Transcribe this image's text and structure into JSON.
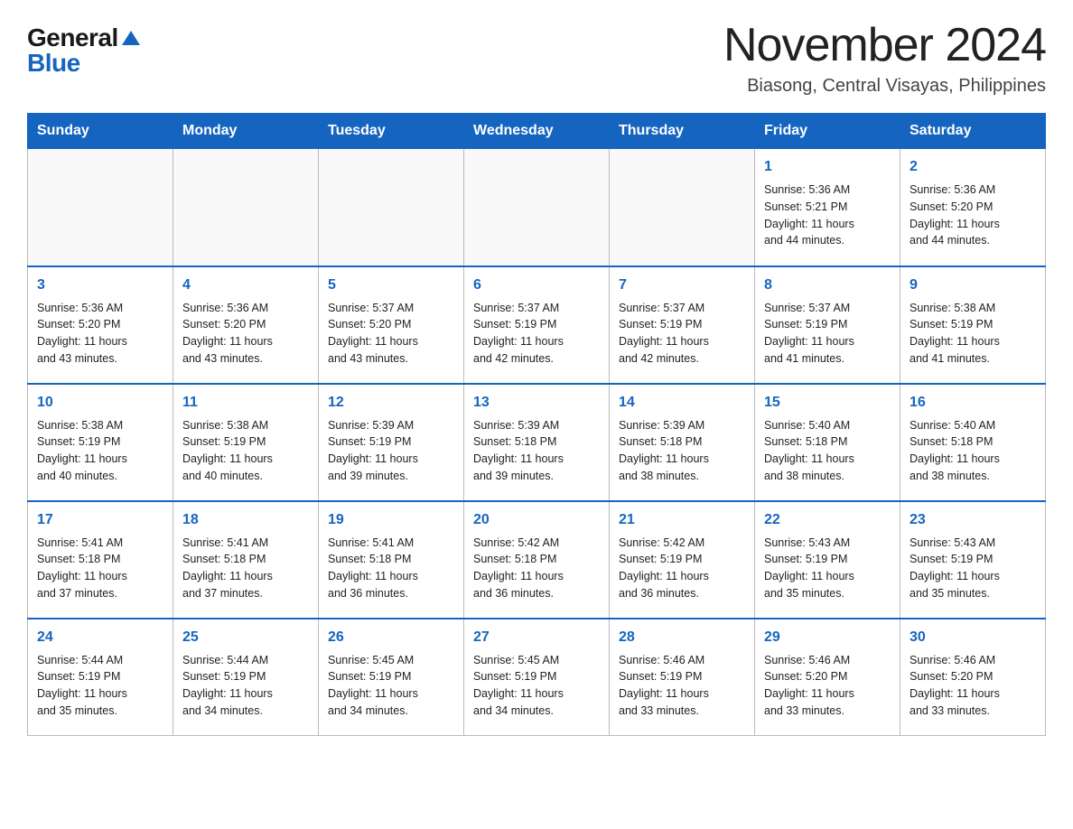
{
  "header": {
    "logo_general": "General",
    "logo_blue": "Blue",
    "month_title": "November 2024",
    "location": "Biasong, Central Visayas, Philippines"
  },
  "days_of_week": [
    "Sunday",
    "Monday",
    "Tuesday",
    "Wednesday",
    "Thursday",
    "Friday",
    "Saturday"
  ],
  "weeks": [
    [
      {
        "day": "",
        "info": ""
      },
      {
        "day": "",
        "info": ""
      },
      {
        "day": "",
        "info": ""
      },
      {
        "day": "",
        "info": ""
      },
      {
        "day": "",
        "info": ""
      },
      {
        "day": "1",
        "info": "Sunrise: 5:36 AM\nSunset: 5:21 PM\nDaylight: 11 hours\nand 44 minutes."
      },
      {
        "day": "2",
        "info": "Sunrise: 5:36 AM\nSunset: 5:20 PM\nDaylight: 11 hours\nand 44 minutes."
      }
    ],
    [
      {
        "day": "3",
        "info": "Sunrise: 5:36 AM\nSunset: 5:20 PM\nDaylight: 11 hours\nand 43 minutes."
      },
      {
        "day": "4",
        "info": "Sunrise: 5:36 AM\nSunset: 5:20 PM\nDaylight: 11 hours\nand 43 minutes."
      },
      {
        "day": "5",
        "info": "Sunrise: 5:37 AM\nSunset: 5:20 PM\nDaylight: 11 hours\nand 43 minutes."
      },
      {
        "day": "6",
        "info": "Sunrise: 5:37 AM\nSunset: 5:19 PM\nDaylight: 11 hours\nand 42 minutes."
      },
      {
        "day": "7",
        "info": "Sunrise: 5:37 AM\nSunset: 5:19 PM\nDaylight: 11 hours\nand 42 minutes."
      },
      {
        "day": "8",
        "info": "Sunrise: 5:37 AM\nSunset: 5:19 PM\nDaylight: 11 hours\nand 41 minutes."
      },
      {
        "day": "9",
        "info": "Sunrise: 5:38 AM\nSunset: 5:19 PM\nDaylight: 11 hours\nand 41 minutes."
      }
    ],
    [
      {
        "day": "10",
        "info": "Sunrise: 5:38 AM\nSunset: 5:19 PM\nDaylight: 11 hours\nand 40 minutes."
      },
      {
        "day": "11",
        "info": "Sunrise: 5:38 AM\nSunset: 5:19 PM\nDaylight: 11 hours\nand 40 minutes."
      },
      {
        "day": "12",
        "info": "Sunrise: 5:39 AM\nSunset: 5:19 PM\nDaylight: 11 hours\nand 39 minutes."
      },
      {
        "day": "13",
        "info": "Sunrise: 5:39 AM\nSunset: 5:18 PM\nDaylight: 11 hours\nand 39 minutes."
      },
      {
        "day": "14",
        "info": "Sunrise: 5:39 AM\nSunset: 5:18 PM\nDaylight: 11 hours\nand 38 minutes."
      },
      {
        "day": "15",
        "info": "Sunrise: 5:40 AM\nSunset: 5:18 PM\nDaylight: 11 hours\nand 38 minutes."
      },
      {
        "day": "16",
        "info": "Sunrise: 5:40 AM\nSunset: 5:18 PM\nDaylight: 11 hours\nand 38 minutes."
      }
    ],
    [
      {
        "day": "17",
        "info": "Sunrise: 5:41 AM\nSunset: 5:18 PM\nDaylight: 11 hours\nand 37 minutes."
      },
      {
        "day": "18",
        "info": "Sunrise: 5:41 AM\nSunset: 5:18 PM\nDaylight: 11 hours\nand 37 minutes."
      },
      {
        "day": "19",
        "info": "Sunrise: 5:41 AM\nSunset: 5:18 PM\nDaylight: 11 hours\nand 36 minutes."
      },
      {
        "day": "20",
        "info": "Sunrise: 5:42 AM\nSunset: 5:18 PM\nDaylight: 11 hours\nand 36 minutes."
      },
      {
        "day": "21",
        "info": "Sunrise: 5:42 AM\nSunset: 5:19 PM\nDaylight: 11 hours\nand 36 minutes."
      },
      {
        "day": "22",
        "info": "Sunrise: 5:43 AM\nSunset: 5:19 PM\nDaylight: 11 hours\nand 35 minutes."
      },
      {
        "day": "23",
        "info": "Sunrise: 5:43 AM\nSunset: 5:19 PM\nDaylight: 11 hours\nand 35 minutes."
      }
    ],
    [
      {
        "day": "24",
        "info": "Sunrise: 5:44 AM\nSunset: 5:19 PM\nDaylight: 11 hours\nand 35 minutes."
      },
      {
        "day": "25",
        "info": "Sunrise: 5:44 AM\nSunset: 5:19 PM\nDaylight: 11 hours\nand 34 minutes."
      },
      {
        "day": "26",
        "info": "Sunrise: 5:45 AM\nSunset: 5:19 PM\nDaylight: 11 hours\nand 34 minutes."
      },
      {
        "day": "27",
        "info": "Sunrise: 5:45 AM\nSunset: 5:19 PM\nDaylight: 11 hours\nand 34 minutes."
      },
      {
        "day": "28",
        "info": "Sunrise: 5:46 AM\nSunset: 5:19 PM\nDaylight: 11 hours\nand 33 minutes."
      },
      {
        "day": "29",
        "info": "Sunrise: 5:46 AM\nSunset: 5:20 PM\nDaylight: 11 hours\nand 33 minutes."
      },
      {
        "day": "30",
        "info": "Sunrise: 5:46 AM\nSunset: 5:20 PM\nDaylight: 11 hours\nand 33 minutes."
      }
    ]
  ]
}
